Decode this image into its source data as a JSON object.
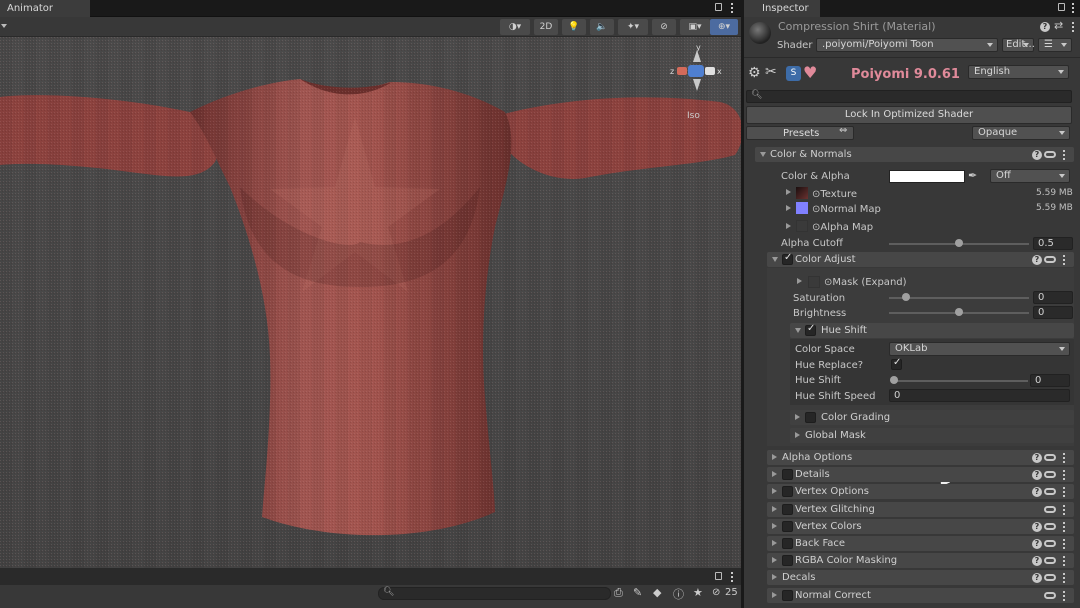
{
  "scene": {
    "tab_label": "Animator",
    "toolbar": {
      "mode_2d": "2D"
    },
    "gizmo": {
      "label": "Iso",
      "axis_x": "x",
      "axis_y": "y",
      "axis_z": "z"
    },
    "bottom": {
      "layer_count": "25"
    }
  },
  "inspector": {
    "tab_label": "Inspector",
    "material_title": "Compression Shirt (Material)",
    "shader_label": "Shader",
    "shader_value": ".poiyomi/Poiyomi Toon",
    "edit_label": "Edit...",
    "brand": "Poiyomi 9.0.61",
    "language": "English",
    "search_placeholder": "",
    "lock_button": "Lock In Optimized Shader",
    "presets_label": "Presets",
    "render_mode": "Opaque",
    "color_normals": {
      "title": "Color & Normals",
      "color_alpha_label": "Color & Alpha",
      "color_alpha_mode": "Off",
      "texture_label": "Texture",
      "texture_size": "5.59 MB",
      "normal_map_label": "Normal Map",
      "normal_map_size": "5.59 MB",
      "alpha_map_label": "Alpha Map",
      "alpha_cutoff_label": "Alpha Cutoff",
      "alpha_cutoff_value": "0.5",
      "alpha_cutoff_level": 0.5
    },
    "color_adjust": {
      "title": "Color Adjust",
      "mask_label": "Mask (Expand)",
      "saturation_label": "Saturation",
      "saturation_value": "0",
      "saturation_level": 0.1,
      "brightness_label": "Brightness",
      "brightness_value": "0",
      "brightness_level": 0.5,
      "hue_shift_section": "Hue Shift",
      "color_space_label": "Color Space",
      "color_space_value": "OKLab",
      "hue_replace_label": "Hue Replace?",
      "hue_shift_label": "Hue Shift",
      "hue_shift_value": "0",
      "hue_shift_level": 0.0,
      "hue_shift_speed_label": "Hue Shift Speed",
      "hue_shift_speed_value": "0",
      "color_grading_label": "Color Grading",
      "global_mask_label": "Global Mask"
    },
    "sections": [
      {
        "label": "Alpha Options"
      },
      {
        "label": "Details"
      },
      {
        "label": "Vertex Options"
      },
      {
        "label": "Vertex Glitching"
      },
      {
        "label": "Vertex Colors"
      },
      {
        "label": "Back Face"
      },
      {
        "label": "RGBA Color Masking"
      },
      {
        "label": "Decals"
      },
      {
        "label": "Normal Correct"
      }
    ]
  },
  "colors": {
    "shirt": "#9a4a44",
    "accent_pink": "#e08a9a",
    "panel": "#383838",
    "section": "#474747"
  }
}
